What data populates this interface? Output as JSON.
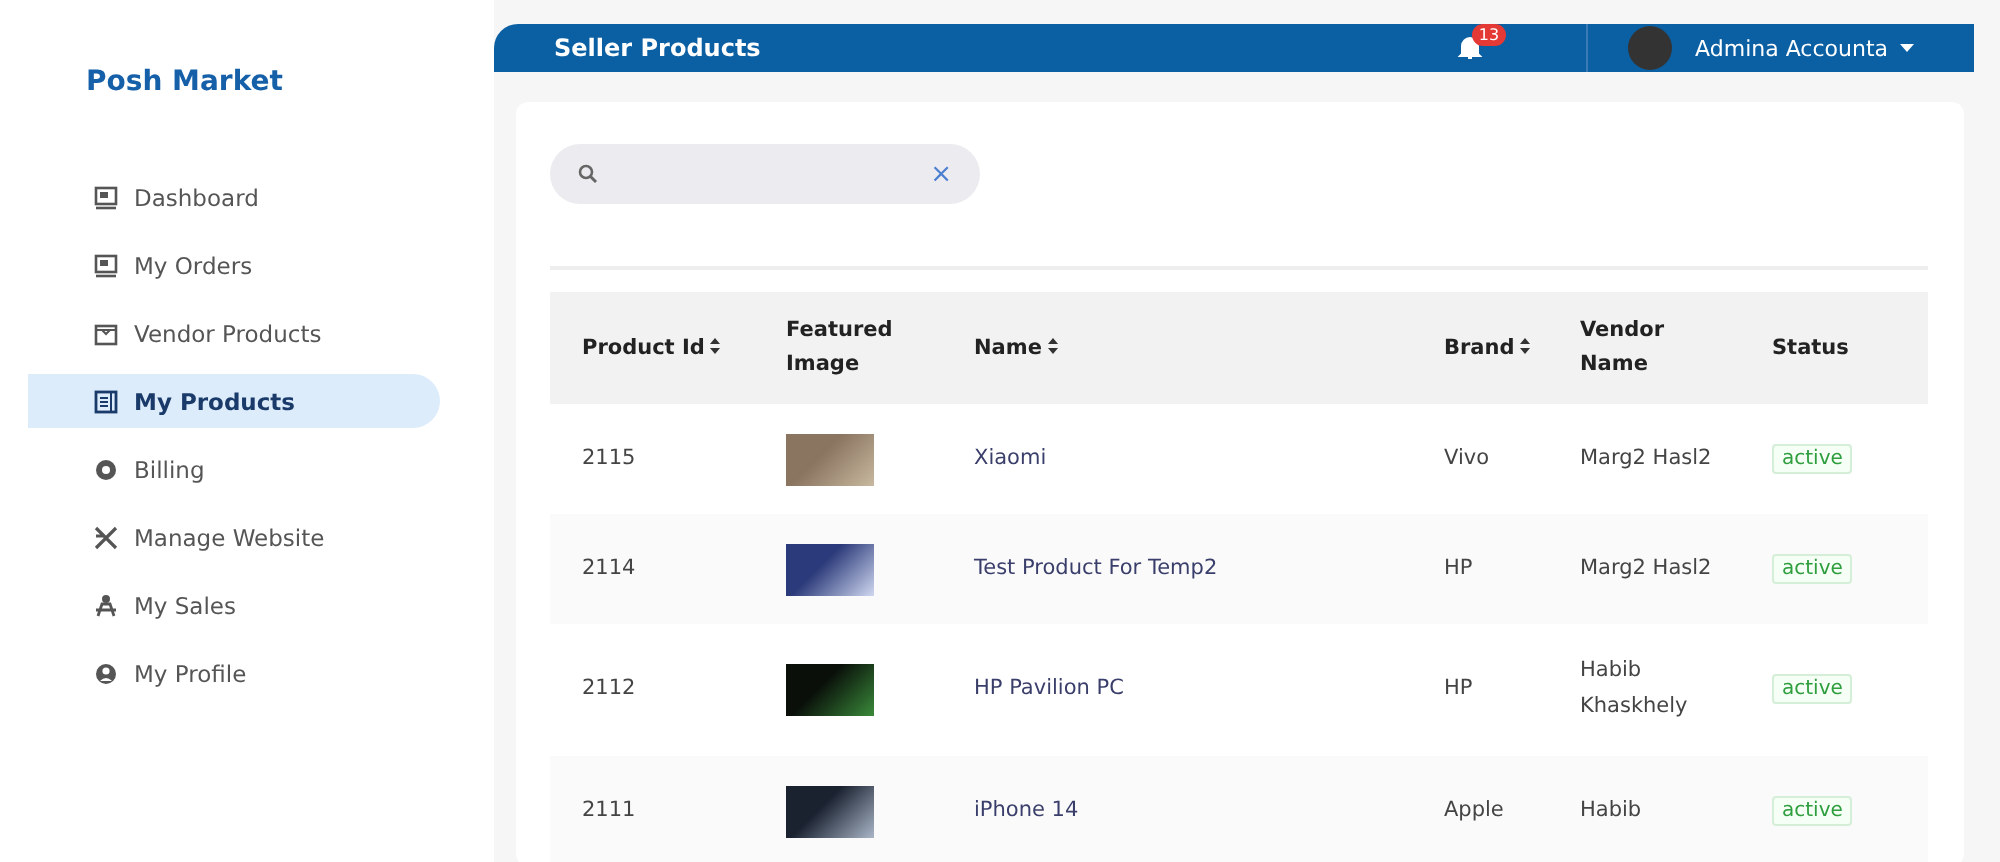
{
  "brand": "Posh Market",
  "sidebar": {
    "items": [
      {
        "label": "Dashboard",
        "selected": false
      },
      {
        "label": "My Orders",
        "selected": false
      },
      {
        "label": "Vendor Products",
        "selected": false
      },
      {
        "label": "My Products",
        "selected": true
      },
      {
        "label": "Billing",
        "selected": false
      },
      {
        "label": "Manage Website",
        "selected": false
      },
      {
        "label": "My Sales",
        "selected": false
      },
      {
        "label": "My Profile",
        "selected": false
      }
    ]
  },
  "header": {
    "title": "Seller Products",
    "notification_count": "13",
    "user_name": "Admina Accounta"
  },
  "search": {
    "clear_icon": "×"
  },
  "table": {
    "columns": [
      {
        "label": "Product Id",
        "sortable": true
      },
      {
        "label": "Featured Image",
        "sortable": false
      },
      {
        "label": "Name",
        "sortable": true
      },
      {
        "label": "Brand",
        "sortable": true
      },
      {
        "label": "Vendor Name",
        "sortable": false
      },
      {
        "label": "Status",
        "sortable": false
      }
    ],
    "rows": [
      {
        "id": "2115",
        "name": "Xiaomi",
        "brand": "Vivo",
        "vendor": "Marg2 Hasl2",
        "status": "active"
      },
      {
        "id": "2114",
        "name": "Test Product For Temp2",
        "brand": "HP",
        "vendor": "Marg2 Hasl2",
        "status": "active"
      },
      {
        "id": "2112",
        "name": "HP Pavilion PC",
        "brand": "HP",
        "vendor": "Habib Khaskhely",
        "status": "active"
      },
      {
        "id": "2111",
        "name": "iPhone 14",
        "brand": "Apple",
        "vendor": "Habib",
        "status": "active"
      }
    ]
  }
}
